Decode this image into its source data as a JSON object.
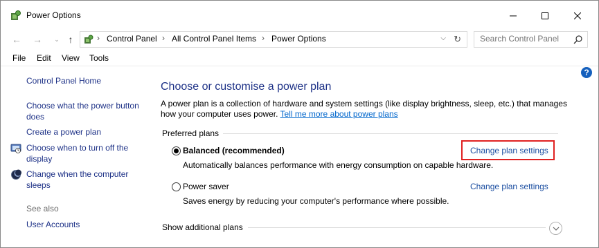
{
  "window": {
    "title": "Power Options",
    "controls": {
      "minimize_icon": "minimize-icon",
      "maximize_icon": "maximize-icon",
      "close_icon": "close-icon"
    }
  },
  "address_bar": {
    "breadcrumbs": [
      "Control Panel",
      "All Control Panel Items",
      "Power Options"
    ],
    "search_placeholder": "Search Control Panel"
  },
  "menu": {
    "items": [
      "File",
      "Edit",
      "View",
      "Tools"
    ]
  },
  "sidebar": {
    "home": "Control Panel Home",
    "links": [
      {
        "line1": "Choose what the power button",
        "line2": "does"
      },
      {
        "line1": "Create a power plan",
        "line2": ""
      },
      {
        "line1": "Choose when to turn off the",
        "line2": "display",
        "icon": "display-icon"
      },
      {
        "line1": "Change when the computer",
        "line2": "sleeps",
        "icon": "moon-icon"
      }
    ],
    "see_also": "See also",
    "see_also_links": [
      "User Accounts"
    ]
  },
  "main": {
    "heading": "Choose or customise a power plan",
    "description_line1": "A power plan is a collection of hardware and system settings (like display brightness, sleep, etc.) that manages",
    "description_line2": "how your computer uses power.",
    "description_link": "Tell me more about power plans",
    "preferred_label": "Preferred plans",
    "plans": [
      {
        "name": "Balanced (recommended)",
        "selected": true,
        "description": "Automatically balances performance with energy consumption on capable hardware.",
        "link": "Change plan settings"
      },
      {
        "name": "Power saver",
        "selected": false,
        "description": "Saves energy by reducing your computer's performance where possible.",
        "link": "Change plan settings"
      }
    ],
    "additional_label": "Show additional plans"
  },
  "colors": {
    "link": "#1e3287",
    "highlight": "#e02020",
    "help_badge": "#1560bd"
  }
}
